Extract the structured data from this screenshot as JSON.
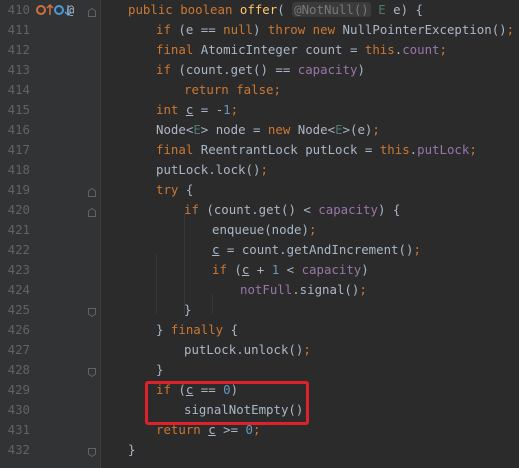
{
  "editor": {
    "gutter_icon_names": [
      "implementation-override-icon",
      "overridden-method-icon",
      "annotation-icon"
    ],
    "lines": [
      {
        "num": "410",
        "code": "public boolean offer( @NotNull() E e) {"
      },
      {
        "num": "411",
        "code": "if (e == null) throw new NullPointerException();"
      },
      {
        "num": "412",
        "code": "final AtomicInteger count = this.count;"
      },
      {
        "num": "413",
        "code": "if (count.get() == capacity)"
      },
      {
        "num": "414",
        "code": "return false;"
      },
      {
        "num": "415",
        "code": "int c = -1;"
      },
      {
        "num": "416",
        "code": "Node<E> node = new Node<E>(e);"
      },
      {
        "num": "417",
        "code": "final ReentrantLock putLock = this.putLock;"
      },
      {
        "num": "418",
        "code": "putLock.lock();"
      },
      {
        "num": "419",
        "code": "try {"
      },
      {
        "num": "420",
        "code": "if (count.get() < capacity) {"
      },
      {
        "num": "421",
        "code": "enqueue(node);"
      },
      {
        "num": "422",
        "code": "c = count.getAndIncrement();"
      },
      {
        "num": "423",
        "code": "if (c + 1 < capacity)"
      },
      {
        "num": "424",
        "code": "notFull.signal();"
      },
      {
        "num": "425",
        "code": "}"
      },
      {
        "num": "426",
        "code": "} finally {"
      },
      {
        "num": "427",
        "code": "putLock.unlock();"
      },
      {
        "num": "428",
        "code": "}"
      },
      {
        "num": "429",
        "code": "if (c == 0)"
      },
      {
        "num": "430",
        "code": "signalNotEmpty();"
      },
      {
        "num": "431",
        "code": "return c >= 0;"
      },
      {
        "num": "432",
        "code": "}"
      }
    ]
  },
  "colors": {
    "background": "#2b2b2b",
    "gutter": "#313335",
    "keyword": "#cc7832",
    "field": "#9876aa",
    "number": "#6897bb",
    "method_decl": "#ffc66d",
    "highlight_box": "#e0202a"
  }
}
